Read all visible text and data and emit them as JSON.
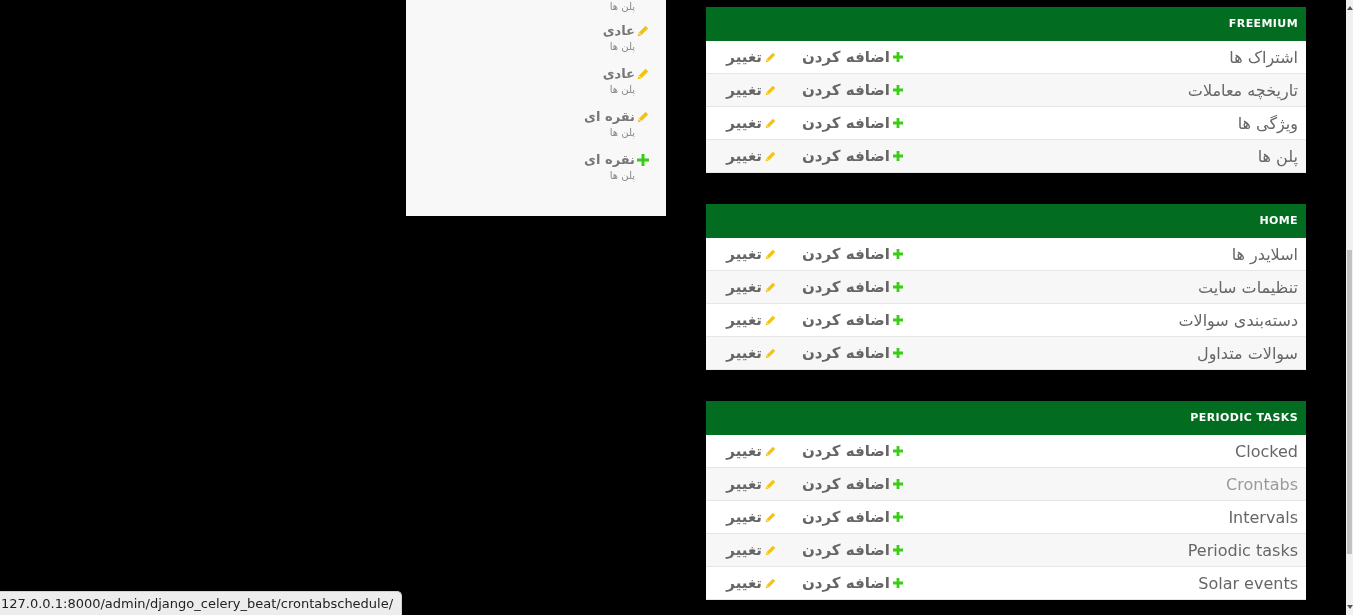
{
  "recent_actions": {
    "items": [
      {
        "content_type": "پلن ها"
      },
      {
        "kind": "change",
        "title": "عادی",
        "content_type": "پلن ها"
      },
      {
        "kind": "change",
        "title": "عادی",
        "content_type": "پلن ها"
      },
      {
        "kind": "change",
        "title": "نقره ای",
        "content_type": "پلن ها"
      },
      {
        "kind": "add",
        "title": "نقره ای",
        "content_type": "پلن ها"
      }
    ]
  },
  "modules": [
    {
      "caption": "FREEMIUM",
      "rows": [
        {
          "name": "اشتراک ها",
          "add_label": "اضافه کردن",
          "change_label": "تغییر",
          "hovered": false
        },
        {
          "name": "تاریخچه معاملات",
          "add_label": "اضافه کردن",
          "change_label": "تغییر",
          "hovered": false
        },
        {
          "name": "ویژگی ها",
          "add_label": "اضافه کردن",
          "change_label": "تغییر",
          "hovered": false
        },
        {
          "name": "پلن ها",
          "add_label": "اضافه کردن",
          "change_label": "تغییر",
          "hovered": false
        }
      ]
    },
    {
      "caption": "HOME",
      "rows": [
        {
          "name": "اسلایدر ها",
          "add_label": "اضافه کردن",
          "change_label": "تغییر",
          "hovered": false
        },
        {
          "name": "تنظیمات سایت",
          "add_label": "اضافه کردن",
          "change_label": "تغییر",
          "hovered": false
        },
        {
          "name": "دسته‌بندی سوالات",
          "add_label": "اضافه کردن",
          "change_label": "تغییر",
          "hovered": false
        },
        {
          "name": "سوالات متداول",
          "add_label": "اضافه کردن",
          "change_label": "تغییر",
          "hovered": false
        }
      ]
    },
    {
      "caption": "PERIODIC TASKS",
      "rows": [
        {
          "name": "Clocked",
          "add_label": "اضافه کردن",
          "change_label": "تغییر",
          "hovered": false
        },
        {
          "name": "Crontabs",
          "add_label": "اضافه کردن",
          "change_label": "تغییر",
          "hovered": true
        },
        {
          "name": "Intervals",
          "add_label": "اضافه کردن",
          "change_label": "تغییر",
          "hovered": false
        },
        {
          "name": "Periodic tasks",
          "add_label": "اضافه کردن",
          "change_label": "تغییر",
          "hovered": false
        },
        {
          "name": "Solar events",
          "add_label": "اضافه کردن",
          "change_label": "تغییر",
          "hovered": false
        }
      ]
    }
  ],
  "status_bar": {
    "url": "127.0.0.1:8000/admin/django_celery_beat/crontabschedule/"
  }
}
